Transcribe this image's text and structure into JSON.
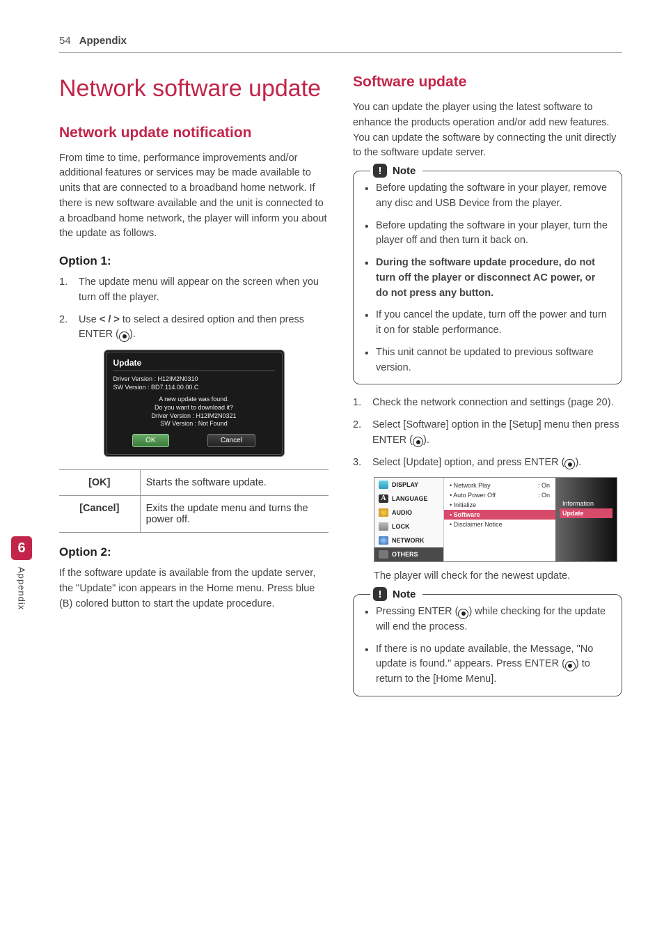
{
  "header": {
    "page": "54",
    "section": "Appendix"
  },
  "sideTab": {
    "num": "6",
    "label": "Appendix"
  },
  "left": {
    "h1": "Network software update",
    "h2": "Network update notification",
    "intro": "From time to time, performance improvements and/or additional features or services may be made available to units that are connected to a broadband home network. If there is new software available and the unit is connected to a broadband home network, the player will inform you about the update as follows.",
    "opt1_h": "Option 1:",
    "opt1_steps": [
      "The update menu will appear on the screen when you turn off the player.",
      "Use a/d to select a desired option and then press ENTER (b)."
    ],
    "shot": {
      "title": "Update",
      "l1": "Driver Version : H12IM2N0310",
      "l2": "SW Version : BD7.114.00.00.C",
      "c1": "A new update was found.",
      "c2": "Do you want to download it?",
      "c3": "Driver Version : H12IM2N0321",
      "c4": "SW Version : Not Found",
      "ok": "OK",
      "cancel": "Cancel"
    },
    "table": {
      "ok_k": "[OK]",
      "ok_v": "Starts the software update.",
      "cancel_k": "[Cancel]",
      "cancel_v": "Exits the update menu and turns the power off."
    },
    "opt2_h": "Option 2:",
    "opt2_p": "If the software update is available from the update server, the \"Update\" icon appears in the Home menu. Press blue (B) colored button to start the update procedure."
  },
  "right": {
    "h2": "Software update",
    "intro": "You can update the player using the latest software to enhance the products operation and/or add new features. You can update the software by connecting the unit directly to the software update server.",
    "noteLabel": "Note",
    "note1": [
      "Before updating the software in your player, remove any disc and USB Device from the player.",
      "Before updating the software in your player, turn the player off and then turn it back on.",
      "During the software update procedure, do not turn off the player or disconnect AC power, or do not press any button.",
      "If you cancel the update, turn off the power and turn it on for stable performance.",
      "This unit cannot be updated to previous software version."
    ],
    "steps": [
      "Check the network connection and settings (page 20).",
      "Select [Software] option in the [Setup] menu then press ENTER (b).",
      "Select [Update] option, and press ENTER (b)."
    ],
    "menuShot": {
      "left": [
        "DISPLAY",
        "LANGUAGE",
        "AUDIO",
        "LOCK",
        "NETWORK",
        "OTHERS"
      ],
      "mid": [
        {
          "l": "Network Play",
          "r": ": On"
        },
        {
          "l": "Auto Power Off",
          "r": ": On"
        },
        {
          "l": "Initialize",
          "r": ""
        },
        {
          "l": "Software",
          "r": "",
          "sel": true
        },
        {
          "l": "Disclaimer Notice",
          "r": ""
        }
      ],
      "right": [
        "Information",
        "Update"
      ]
    },
    "playerCheck": "The player will check for the newest update.",
    "note2": [
      "Pressing ENTER (b) while checking for the update will end the process.",
      "If there is no update available, the Message, \"No update is found.\" appears. Press ENTER (b) to return to the [Home Menu]."
    ]
  }
}
